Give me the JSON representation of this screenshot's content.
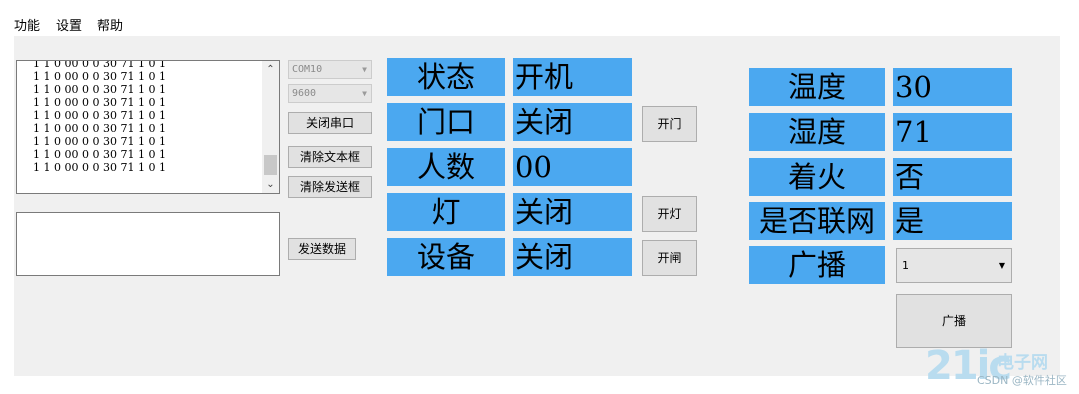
{
  "menu": {
    "items": [
      "功能",
      "设置",
      "帮助"
    ]
  },
  "serial": {
    "receive_lines": [
      "1 1 0 00 0 0 30 71 1 0 1",
      "1 1 0 00 0 0 30 71 1 0 1",
      "1 1 0 00 0 0 30 71 1 0 1",
      "1 1 0 00 0 0 30 71 1 0 1",
      "1 1 0 00 0 0 30 71 1 0 1",
      "1 1 0 00 0 0 30 71 1 0 1",
      "1 1 0 00 0 0 30 71 1 0 1",
      "1 1 0 00 0 0 30 71 1 0 1",
      "1 1 0 00 0 0 30 71 1 0 1"
    ],
    "port": "COM10",
    "baud": "9600",
    "close_port_label": "关闭串口",
    "clear_text_label": "清除文本框",
    "clear_send_label": "清除发送框",
    "send_data_label": "发送数据",
    "send_text": ""
  },
  "device_panel": {
    "rows": [
      {
        "label": "状态",
        "value": "开机"
      },
      {
        "label": "门口",
        "value": "关闭"
      },
      {
        "label": "人数",
        "value": "00"
      },
      {
        "label": "灯",
        "value": "关闭"
      },
      {
        "label": "设备",
        "value": "关闭"
      }
    ],
    "open_door_label": "开门",
    "open_light_label": "开灯",
    "open_gate_label": "开闸"
  },
  "env_panel": {
    "rows": [
      {
        "label": "温度",
        "value": "30"
      },
      {
        "label": "湿度",
        "value": "71"
      },
      {
        "label": "着火",
        "value": "否"
      },
      {
        "label": "是否联网",
        "value": "是"
      },
      {
        "label": "广播",
        "value": ""
      }
    ],
    "broadcast_select": "1",
    "broadcast_button": "广播"
  },
  "icons": {
    "scroll_up": "chevron-up-icon",
    "scroll_down": "chevron-down-icon",
    "dropdown": "caret-down-icon"
  },
  "colors": {
    "accent": "#4ba8f0",
    "client_bg": "#f0f0f0"
  },
  "watermark": {
    "logo": "21ic",
    "name": "电子网",
    "sub": "CSDN @软件社区"
  }
}
